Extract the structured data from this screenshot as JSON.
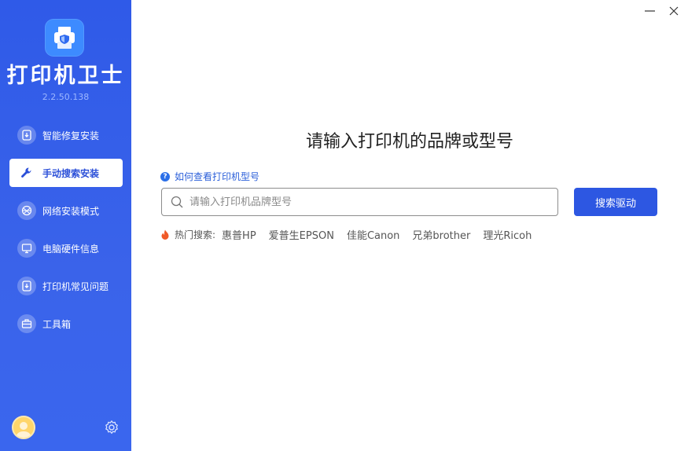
{
  "app": {
    "name": "打印机卫士",
    "version": "2.2.50.138"
  },
  "sidebar": {
    "items": [
      {
        "label": "智能修复安装",
        "icon": "download-repair-icon",
        "active": false
      },
      {
        "label": "手动搜索安装",
        "icon": "wrench-icon",
        "active": true
      },
      {
        "label": "网络安装模式",
        "icon": "network-icon",
        "active": false
      },
      {
        "label": "电脑硬件信息",
        "icon": "hardware-info-icon",
        "active": false
      },
      {
        "label": "打印机常见问题",
        "icon": "faq-download-icon",
        "active": false
      },
      {
        "label": "工具箱",
        "icon": "toolbox-icon",
        "active": false
      }
    ]
  },
  "main": {
    "title": "请输入打印机的品牌或型号",
    "help_link": "如何查看打印机型号",
    "search": {
      "placeholder": "请输入打印机品牌型号",
      "value": "",
      "button_label": "搜索驱动"
    },
    "hot": {
      "label": "热门搜索:",
      "keywords": [
        "惠普HP",
        "爱普生EPSON",
        "佳能Canon",
        "兄弟brother",
        "理光Ricoh"
      ]
    }
  },
  "colors": {
    "sidebar_bg": "#2f5ae8",
    "accent": "#2d57e2",
    "link": "#2b5fd9",
    "hot_icon": "#f05a28"
  }
}
